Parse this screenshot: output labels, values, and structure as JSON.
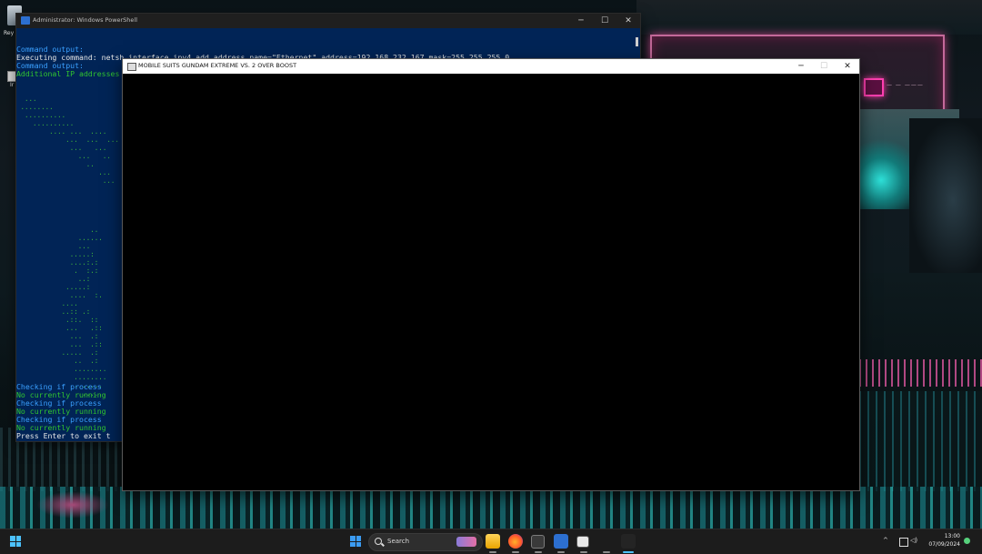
{
  "desktop": {
    "icon_labels": [
      "Rey",
      "Ir"
    ]
  },
  "powershell": {
    "title": "Administrator: Windows PowerShell",
    "lines": [
      {
        "text": "Command output:",
        "color": "blue"
      },
      {
        "text": "Executing command: netsh interface ipv4 add address name=\"Ethernet\" address=192.168.232.167 mask=255.255.255.0",
        "color": "white"
      },
      {
        "text": "Command output:",
        "color": "blue"
      },
      {
        "text": "Additional IP addresses have been added to interface 'Ethernet'",
        "color": "green"
      }
    ],
    "ascii_art": [
      "  ...",
      " ........",
      "  ..........",
      "    ..........",
      "        .... ...  ....",
      "            ...  ...  ...",
      "             ...   ...",
      "               ...   ..",
      "                 ..",
      "                    ...",
      "                     ...",
      "",
      "",
      "",
      "",
      "",
      "                  ..",
      "               ......",
      "               ...",
      "             .....:",
      "             ....:.:",
      "              .  :.:",
      "               ..:",
      "            .....:",
      "             ....  :.",
      "           ....",
      "           ..:: .:",
      "            .::.  ::",
      "            ...   .::",
      "             ...  .:",
      "             ...  .::",
      "           .....  .:",
      "              ..  .:",
      "              ........",
      "              ........",
      "              .......",
      "               ......."
    ],
    "tail_lines": [
      {
        "text": "Checking if process",
        "color": "blue"
      },
      {
        "text": "No currently running",
        "color": "green"
      },
      {
        "text": "Checking if process",
        "color": "blue"
      },
      {
        "text": "No currently running",
        "color": "green"
      },
      {
        "text": "Checking if process",
        "color": "blue"
      },
      {
        "text": "No currently running",
        "color": "green"
      },
      {
        "text": "Press Enter to exit t",
        "color": "white"
      }
    ],
    "controls": {
      "minimize": "─",
      "maximize": "☐",
      "close": "✕"
    }
  },
  "game_window": {
    "title": "MOBILE SUITS GUNDAM EXTREME VS. 2 OVER BOOST",
    "controls": {
      "minimize": "─",
      "maximize": "☐",
      "close": "✕"
    }
  },
  "taskbar": {
    "search_placeholder": "Search",
    "apps": [
      "file-explorer",
      "firefox",
      "terminal-app",
      "powershell",
      "game-app",
      "blank-app",
      "active-app"
    ],
    "tray": {
      "chevron": "^",
      "time": "13:00",
      "date": "07/09/2024"
    }
  },
  "colors": {
    "ps_background": "#012456",
    "ps_blue_text": "#3aa0ff",
    "ps_green_text": "#31c52f",
    "accent": "#4cc2ff"
  }
}
